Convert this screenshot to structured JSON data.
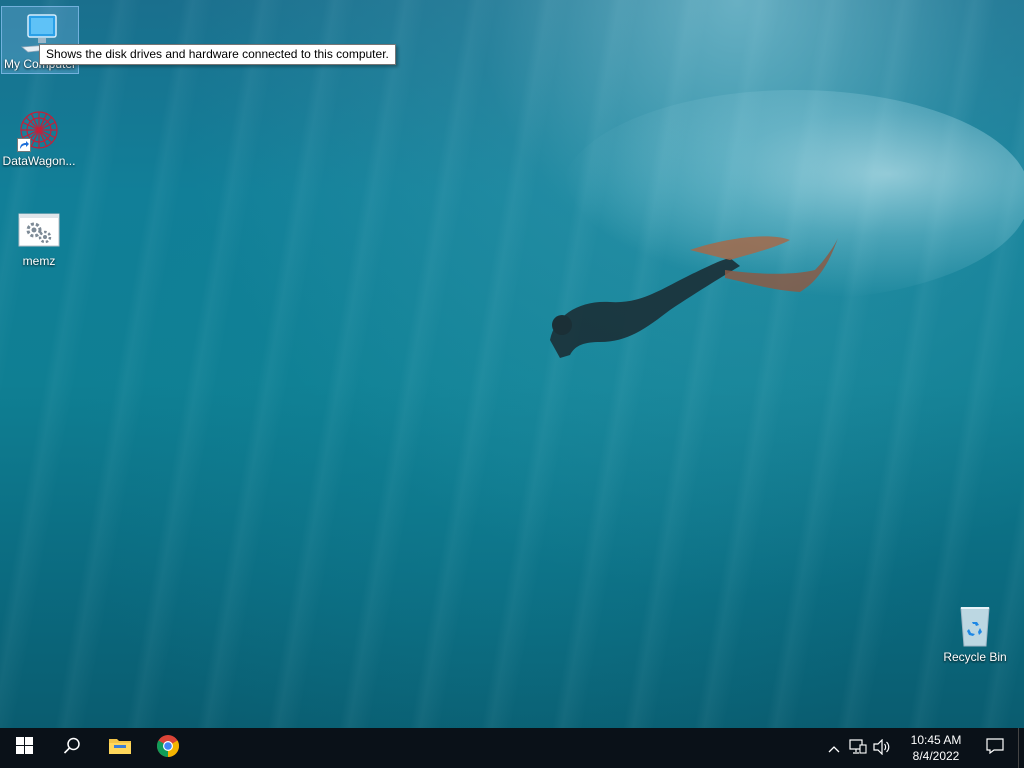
{
  "desktop": {
    "icons": [
      {
        "label": "My Computer",
        "icon": "computer-icon"
      },
      {
        "label": "DataWagon...",
        "icon": "datawagon-icon"
      },
      {
        "label": "memz",
        "icon": "gears-icon"
      },
      {
        "label": "Recycle Bin",
        "icon": "recycle-bin-icon"
      }
    ],
    "tooltip": "Shows the disk drives and hardware connected to this computer."
  },
  "taskbar": {
    "start_icon": "windows-logo-icon",
    "search_icon": "search-icon",
    "pinned": [
      {
        "name": "File Explorer",
        "icon": "folder-icon"
      },
      {
        "name": "Google Chrome",
        "icon": "chrome-icon"
      }
    ],
    "tray": {
      "overflow_icon": "chevron-up-icon",
      "network_icon": "network-icon",
      "volume_icon": "speaker-icon",
      "time": "10:45 AM",
      "date": "8/4/2022",
      "notification_icon": "action-center-icon"
    }
  },
  "colors": {
    "taskbar": "#0a1118",
    "water_top": "#1a6f8d",
    "water_bottom": "#09586b"
  }
}
